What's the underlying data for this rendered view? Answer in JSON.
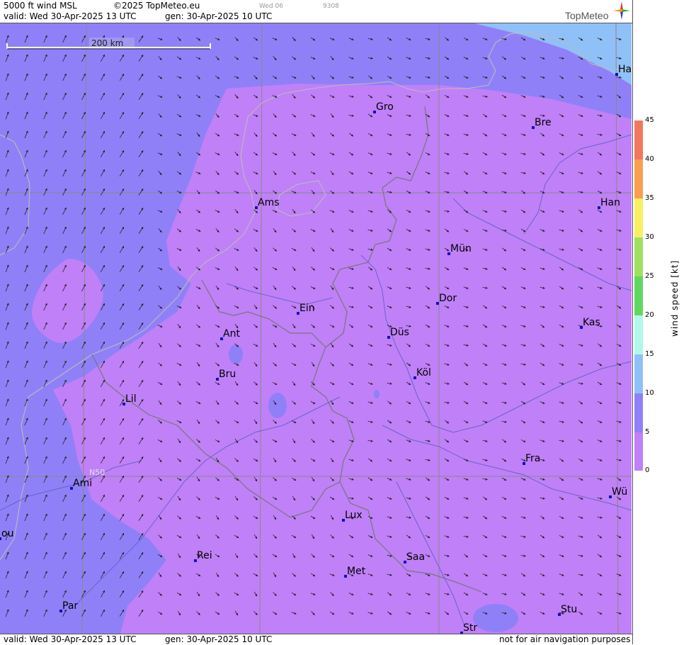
{
  "header": {
    "product": "5000 ft wind MSL",
    "copyright": "©2025 TopMeteo.eu",
    "valid": "valid:  Wed  30-Apr-2025  13 UTC",
    "gen": "gen: 30-Apr-2025 10 UTC",
    "tiny_left": "Wed 06",
    "tiny_right": "9308",
    "logo": "TopMeteo"
  },
  "footer": {
    "valid": "valid:  Wed  30-Apr-2025  13 UTC",
    "gen": "gen: 30-Apr-2025 10 UTC",
    "note": "not for air navigation purposes"
  },
  "map": {
    "scale_label": "200 km",
    "lat_label": "N50",
    "cities": [
      {
        "name": "Gro"
      },
      {
        "name": "Bre"
      },
      {
        "name": "Ha"
      },
      {
        "name": "Ams"
      },
      {
        "name": "Han"
      },
      {
        "name": "Mün"
      },
      {
        "name": "Dor"
      },
      {
        "name": "Ein"
      },
      {
        "name": "Kas"
      },
      {
        "name": "Ant"
      },
      {
        "name": "Düs"
      },
      {
        "name": "Bru"
      },
      {
        "name": "Köl"
      },
      {
        "name": "Lil"
      },
      {
        "name": "Fra"
      },
      {
        "name": "Ami"
      },
      {
        "name": "Wü"
      },
      {
        "name": "ou"
      },
      {
        "name": "Lux"
      },
      {
        "name": "Rei"
      },
      {
        "name": "Saa"
      },
      {
        "name": "Met"
      },
      {
        "name": "Par"
      },
      {
        "name": "Stu"
      },
      {
        "name": "Str"
      }
    ],
    "colors": {
      "calm": "#c080f8",
      "light": "#9080f8",
      "moderate": "#90c0f8"
    }
  },
  "legend": {
    "title": "wind  speed  [kt]",
    "ticks": [
      "45",
      "40",
      "35",
      "30",
      "25",
      "20",
      "15",
      "10",
      "5",
      "0"
    ]
  }
}
